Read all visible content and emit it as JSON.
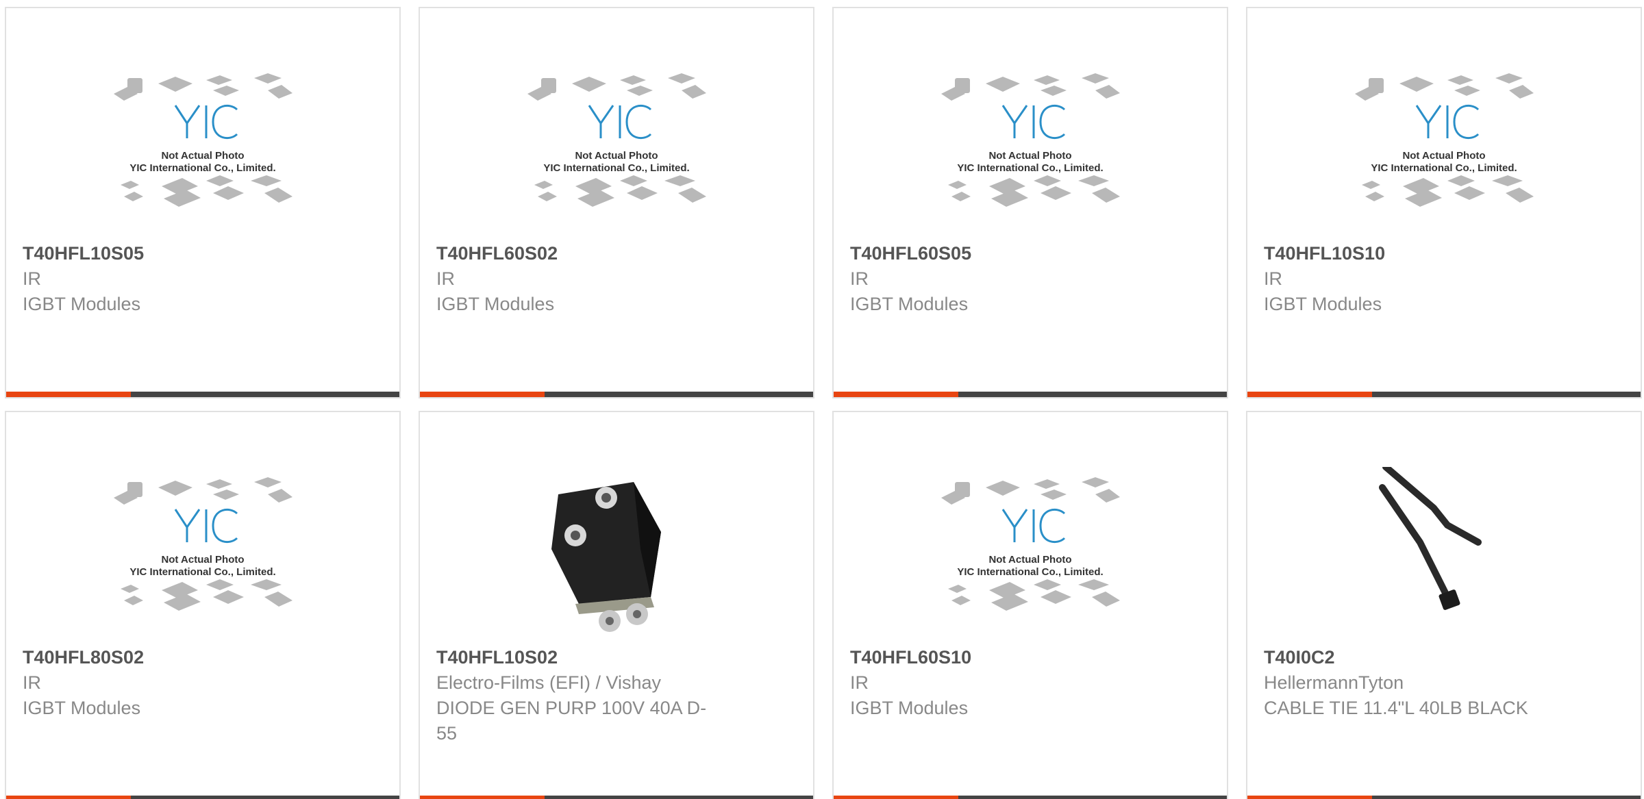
{
  "colors": {
    "accent": "#e84511",
    "bar": "#444444",
    "part_number": "#555555",
    "text_muted": "#888888",
    "yic_logo": "#2a8fc8"
  },
  "placeholder_image": {
    "line1": "Not Actual Photo",
    "line2": "YIC International Co., Limited.",
    "logo_text": "YIC"
  },
  "products": [
    {
      "part_number": "T40HFL10S05",
      "manufacturer": "IR",
      "description": "IGBT Modules",
      "image": "placeholder"
    },
    {
      "part_number": "T40HFL60S02",
      "manufacturer": "IR",
      "description": "IGBT Modules",
      "image": "placeholder"
    },
    {
      "part_number": "T40HFL60S05",
      "manufacturer": "IR",
      "description": "IGBT Modules",
      "image": "placeholder"
    },
    {
      "part_number": "T40HFL10S10",
      "manufacturer": "IR",
      "description": "IGBT Modules",
      "image": "placeholder"
    },
    {
      "part_number": "T40HFL80S02",
      "manufacturer": "IR",
      "description": "IGBT Modules",
      "image": "placeholder"
    },
    {
      "part_number": "T40HFL10S02",
      "manufacturer": "Electro-Films (EFI) / Vishay",
      "description": "DIODE GEN PURP 100V 40A D-55",
      "image": "diode-module"
    },
    {
      "part_number": "T40HFL60S10",
      "manufacturer": "IR",
      "description": "IGBT Modules",
      "image": "placeholder"
    },
    {
      "part_number": "T40I0C2",
      "manufacturer": "HellermannTyton",
      "description": "CABLE TIE 11.4\"L 40LB BLACK",
      "image": "cable-tie"
    }
  ]
}
